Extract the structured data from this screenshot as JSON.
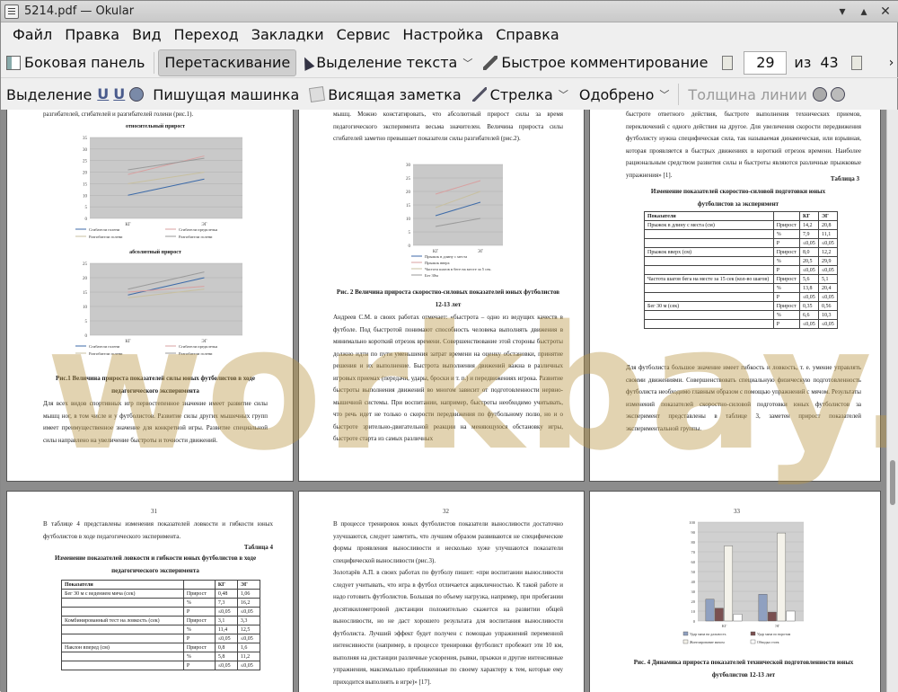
{
  "window": {
    "title": "5214.pdf — Okular"
  },
  "menu": [
    "Файл",
    "Правка",
    "Вид",
    "Переход",
    "Закладки",
    "Сервис",
    "Настройка",
    "Справка"
  ],
  "toolbar1": {
    "sidebar": "Боковая панель",
    "drag": "Перетаскивание",
    "text_select": "Выделение текста",
    "quick_comment": "Быстрое комментирование",
    "page": "29",
    "of": "из",
    "total": "43"
  },
  "toolbar2": {
    "select": "Выделение",
    "typewriter": "Пишущая машинка",
    "note": "Висящая заметка",
    "arrow": "Стрелка",
    "approved": "Одобрено",
    "line_width": "Толщина линии"
  },
  "watermark": {
    "text": "workbay.ru"
  },
  "p1": {
    "intro": "разгибателей, сгибателей и разгибателей голени (рис.1).",
    "c1_title": "относительный прирост",
    "c1": {
      "type": "line",
      "categories": [
        "КГ",
        "ЭГ"
      ],
      "ylim": [
        0,
        35
      ],
      "yticks": [
        "0",
        "5",
        "10",
        "15",
        "20",
        "25",
        "30",
        "35"
      ],
      "series": [
        {
          "name": "Сгибатели голени",
          "values": [
            10,
            17
          ]
        },
        {
          "name": "Сгибатели предплечья",
          "values": [
            19,
            27
          ]
        },
        {
          "name": "Разгибатели голени",
          "values": [
            15,
            20
          ]
        },
        {
          "name": "Разгибатели голени",
          "values": [
            21,
            26
          ]
        }
      ]
    },
    "c2_title": "абсолютный прирост",
    "c2": {
      "type": "line",
      "categories": [
        "КГ",
        "ЭГ"
      ],
      "ylim": [
        0,
        25
      ],
      "yticks": [
        "0",
        "5",
        "10",
        "15",
        "20",
        "25"
      ],
      "series": [
        {
          "name": "Сгибатели голени",
          "values": [
            14,
            20
          ]
        },
        {
          "name": "Сгибатели предплечья",
          "values": [
            15,
            17
          ]
        },
        {
          "name": "Разгибатели голени",
          "values": [
            13,
            16
          ]
        },
        {
          "name": "Разгибатели голени",
          "values": [
            16,
            22
          ]
        }
      ]
    },
    "caption": "Рис.1 Величина прироста показателей силы юных футболистов в ходе педагогического эксперимента",
    "body": "Для всех видов спортивных игр первостепенное значение имеет развитие силы мышц ног, в том числе и у футболистов. Развитие силы других мышечных групп имеет преимущественное значение для конкретной игры. Развитие специальной силы направлено на увеличение быстроты и точности движений."
  },
  "p2": {
    "intro": "мышц. Можно констатировать, что абсолютный прирост силы за время педагогического эксперимента весьма значителен. Величина прироста силы сгибателей заметно превышает показатели силы разгибателей (рис.2).",
    "chart": {
      "type": "line",
      "categories": [
        "КГ",
        "ЭГ"
      ],
      "ylim": [
        0,
        30
      ],
      "yticks": [
        "0",
        "5",
        "10",
        "15",
        "20",
        "25",
        "30"
      ],
      "series": [
        {
          "name": "Прыжок в длину с места",
          "values": [
            11,
            16
          ]
        },
        {
          "name": "Прыжок вверх",
          "values": [
            19,
            24
          ]
        },
        {
          "name": "Частота шагов в беге на месте за 5 сек.",
          "values": [
            14,
            20
          ]
        },
        {
          "name": "Бег 30м",
          "values": [
            7,
            10
          ]
        }
      ]
    },
    "caption": "Рис. 2 Величина прироста скоростно-силовых показателей юных футболистов 12-13 лет",
    "body": "Андреев С.М. в своих работах отмечает: «быстрота – одно из ведущих качеств в футболе. Под быстротой понимают способность человека выполнять движения в минимально короткий отрезок времени. Совершенствование этой стороны быстроты должно идти по пути уменьшения затрат времени на оценку обстановки, принятие решения и их выполнение. Быстрота выполнения движений важна в различных игровых приемах (передачи, удары, броски и т. п.) и передвижениях игрока. Развитие быстроты выполнения движений во многом зависит от подготовленности нервно-мышечной системы. При воспитании, например, быстроты необходимо учитывать, что речь идет не только о скорости передвижения по футбольному полю, но и о быстроте зрительно-двигательной реакции на меняющуюся обстановку игры, быстроте старта из самых различных"
  },
  "p3": {
    "intro": "быстроте ответного действия, быстроте выполнения технических приемов, переключений с одного действия на другое. Для увеличения скорости передвижения футболисту нужна специфическая сила, так называемая динамическая, или взрывная, которая проявляется в быстрых движениях в короткий отрезок времени. Наиболее рациональным средством развития силы и быстроты являются различные прыжковые упражнения» [1].",
    "table_label": "Таблица 3",
    "table_title": "Изменение показателей скоростно-силовой подготовки юных футболистов за эксперимент",
    "headers": [
      "Показатели",
      "",
      "КГ",
      "ЭГ"
    ],
    "rows": [
      [
        "Прыжок в длину с места (см)",
        "Прирост",
        "14,2",
        "20,8"
      ],
      [
        "",
        "%",
        "7,9",
        "11,1"
      ],
      [
        "",
        "P",
        "≤0,05",
        "≤0,05"
      ],
      [
        "Прыжок вверх (см)",
        "Прирост",
        "8,0",
        "12,2"
      ],
      [
        "",
        "%",
        "20,5",
        "29,9"
      ],
      [
        "",
        "P",
        "≤0,05",
        "≤0,05"
      ],
      [
        "Частота шагов бега на месте за 15 сек (кол-во шагов)",
        "Прирост",
        "5,6",
        "5,1"
      ],
      [
        "",
        "%",
        "13,8",
        "20,4"
      ],
      [
        "",
        "P",
        "≤0,05",
        "≤0,05"
      ],
      [
        "Бег 30 м (сек)",
        "Прирост",
        "0,35",
        "0,56"
      ],
      [
        "",
        "%",
        "6,6",
        "10,3"
      ],
      [
        "",
        "P",
        "≤0,05",
        "≤0,05"
      ]
    ],
    "body": "Для футболиста большое значение имеет гибкость и ловкость, т. е. умение управлять своими движениями. Совершенствовать специальную физическую подготовленность футболиста необходимо главным образом с помощью упражнений с мячом. Результаты изменений показателей скоростно-силовой подготовки юных футболистов за эксперимент представлены в таблице 3, заметен прирост показателей экспериментальной группы."
  },
  "p4": {
    "num": "31",
    "intro": "В таблице 4 представлены изменения показателей ловкости и гибкости юных футболистов в ходе педагогического эксперимента.",
    "table_label": "Таблица 4",
    "table_title": "Изменение показателей ловкости и гибкости юных футболистов в ходе педагогического эксперимента",
    "headers": [
      "Показатели",
      "",
      "КГ",
      "ЭГ"
    ],
    "rows": [
      [
        "Бег 30 м с ведением мяча (сек)",
        "Прирост",
        "0,48",
        "1,06"
      ],
      [
        "",
        "%",
        "7,3",
        "16,2"
      ],
      [
        "",
        "P",
        "≤0,05",
        "≤0,05"
      ],
      [
        "Комбинированный тест на ловкость (сек)",
        "Прирост",
        "3,1",
        "3,3"
      ],
      [
        "",
        "%",
        "11,4",
        "12,5"
      ],
      [
        "",
        "P",
        "≤0,05",
        "≤0,05"
      ],
      [
        "Наклон вперед (см)",
        "Прирост",
        "0,8",
        "1,6"
      ],
      [
        "",
        "%",
        "5,8",
        "11,2"
      ],
      [
        "",
        "P",
        "≤0,05",
        "≤0,05"
      ]
    ]
  },
  "p5": {
    "num": "32",
    "body1": "В процессе тренировок юных футболистов показатели выносливости достаточно улучшаются, следует заметить, что лучшим образом развиваются не специфические формы проявления выносливости и несколько хуже улучшаются показатели специфической выносливости (рис.3).",
    "body2": "Золотарёв А.П. в своих работах по футболу пишет: «при воспитании выносливости следует учитывать, что игра в футбол отличается ацикличностью. К такой работе и надо готовить футболистов. Большая по объему нагрузка, например, при пробегании десятикилометровой дистанции положительно скажется на развитии общей выносливости, но не даст хорошего результата для воспитания выносливости футболиста. Лучший эффект будет получен с помощью упражнений переменной интенсивности (например, в процессе тренировки футболист пробежит эти 10 км, выполняя на дистанции различные ускорения, рывки, прыжки и другие интенсивные упражнения, максимально приближенные по своему характеру к тем, которые ему приходится выполнять в игре)» [17]."
  },
  "p6": {
    "num": "33",
    "chart": {
      "type": "bar",
      "categories": [
        "КГ",
        "ЭГ"
      ],
      "ylim": [
        0,
        100
      ],
      "yticks": [
        "0",
        "10",
        "20",
        "30",
        "40",
        "50",
        "60",
        "70",
        "80",
        "90",
        "100"
      ],
      "series": [
        {
          "name": "Удар мяча на дальность",
          "values": [
            22,
            27
          ]
        },
        {
          "name": "Удар мяча по воротам",
          "values": [
            13,
            9
          ]
        },
        {
          "name": "Жонглирование мячом",
          "values": [
            76,
            89
          ]
        },
        {
          "name": "Обводка стоек",
          "values": [
            7,
            10
          ]
        }
      ]
    },
    "caption": "Рис. 4 Динамика прироста показателей технической подготовленности юных футболистов 12-13 лет"
  }
}
